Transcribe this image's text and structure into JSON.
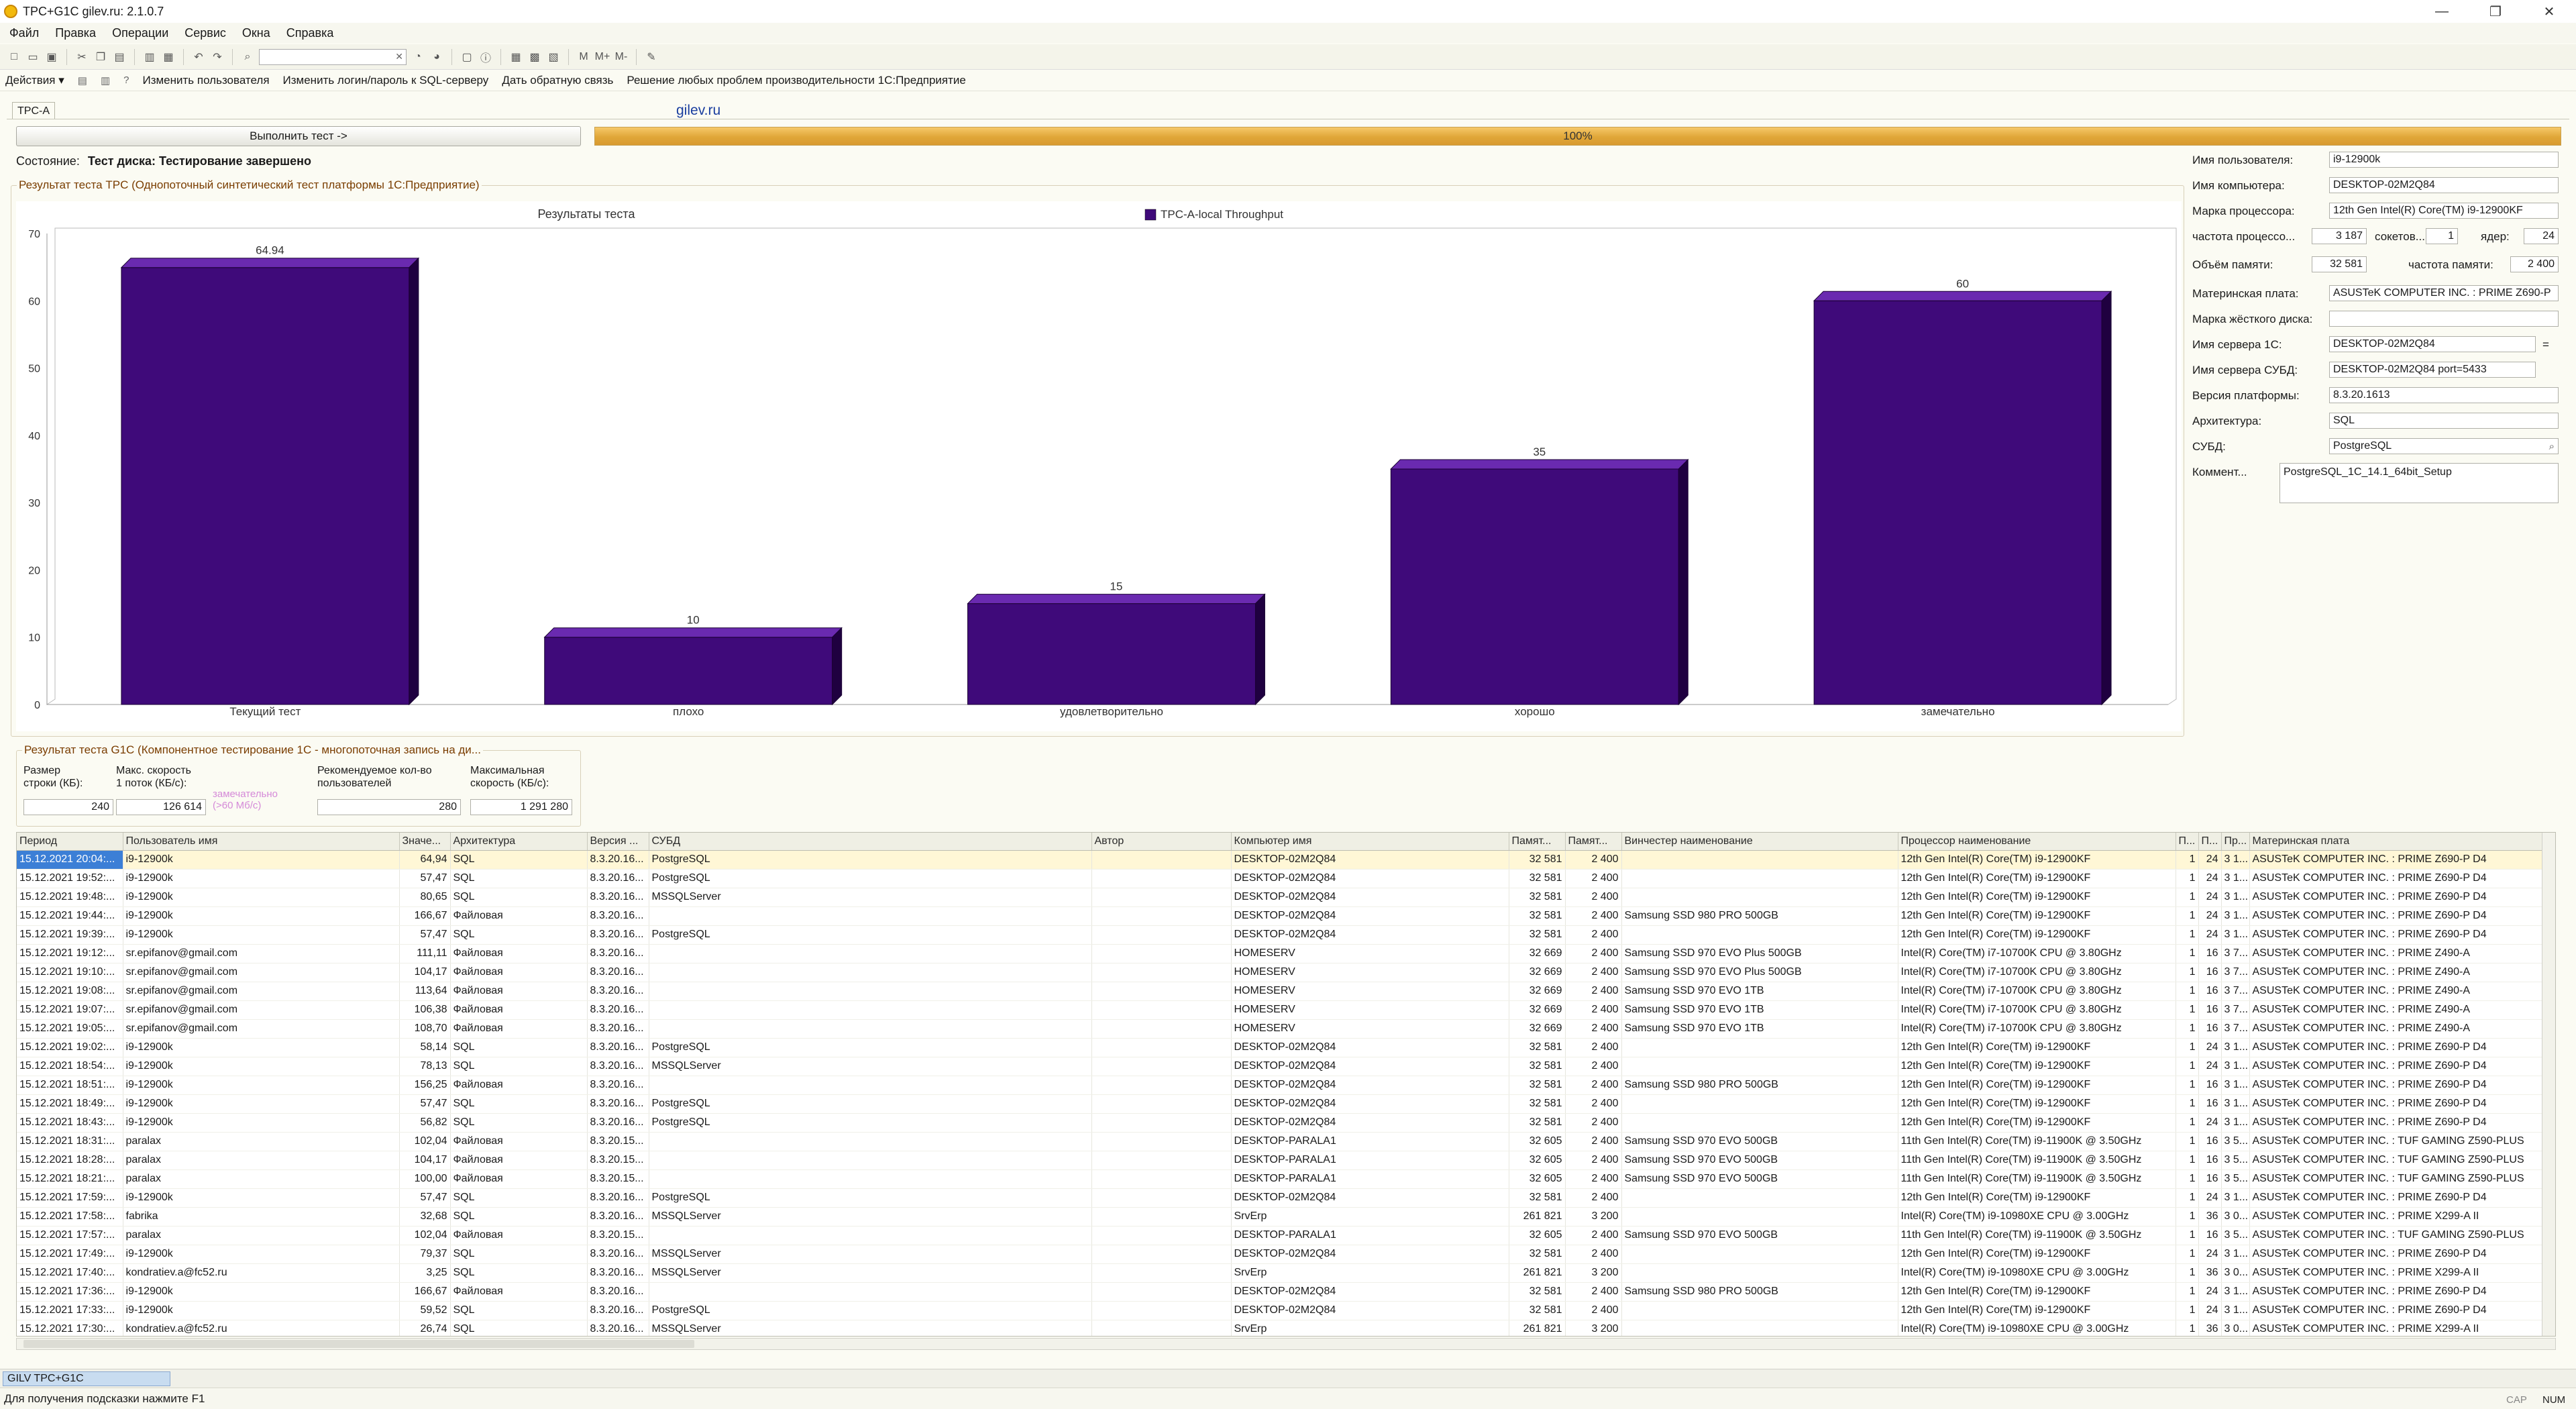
{
  "window": {
    "title": "TPC+G1C gilev.ru: 2.1.0.7",
    "controls": [
      "—",
      "❐",
      "✕"
    ]
  },
  "menu": [
    "Файл",
    "Правка",
    "Операции",
    "Сервис",
    "Окна",
    "Справка"
  ],
  "actions": {
    "menu_label": "Действия ▾",
    "links": [
      "Изменить пользователя",
      "Изменить логин/пароль к SQL-серверу",
      "Дать обратную связь",
      "Решение любых проблем производительности 1С:Предприятие"
    ]
  },
  "tab": {
    "label": "TPC-A"
  },
  "site": "gilev.ru",
  "run_button": "Выполнить тест ->",
  "progress": {
    "label": "100%",
    "value": 100
  },
  "status": {
    "label": "Состояние:",
    "value": "Тест диска: Тестирование завершено"
  },
  "tpc_group": {
    "title": "Результат теста TPC (Однопоточный синтетический тест платформы 1С:Предприятие)"
  },
  "chart_data": {
    "type": "bar",
    "title": "Результаты теста",
    "legend": "top-center",
    "series": [
      {
        "name": "TPC-A-local Throughput",
        "values": [
          64.94,
          10,
          15,
          35,
          60
        ]
      }
    ],
    "categories": [
      "Текущий тест",
      "плохо",
      "удовлетворительно",
      "хорошо",
      "замечательно"
    ],
    "value_labels": [
      "64.94",
      "10",
      "15",
      "35",
      "60"
    ],
    "ylim": [
      0,
      70
    ],
    "yticks": [
      "0",
      "10",
      "20",
      "30",
      "40",
      "50",
      "60",
      "70"
    ],
    "grid": false,
    "colors": {
      "bar": "#3f0a7a",
      "bar_top": "#6a2ab0",
      "bar_side": "#1f0040"
    }
  },
  "g1c_group": {
    "title": "Результат теста G1C (Компонентное тестирование 1С - многопоточная запись на ди...",
    "fields": [
      {
        "label1": "Размер",
        "label2": "строки (КБ):",
        "value": "240"
      },
      {
        "label1": "Макс. скорость",
        "label2": "1 поток (КБ/с):",
        "value": "126 614"
      },
      {
        "label1": "Рекомендуемое кол-во",
        "label2": "пользователей",
        "value": "280"
      },
      {
        "label1": "Максимальная",
        "label2": "скорость (КБ/с):",
        "value": "1 291 280"
      }
    ],
    "rating": {
      "line1": "замечательно",
      "line2": "(>60 Мб/с)"
    }
  },
  "info": {
    "user": {
      "label": "Имя пользователя:",
      "value": "i9-12900k"
    },
    "computer": {
      "label": "Имя компьютера:",
      "value": "DESKTOP-02M2Q84"
    },
    "cpu": {
      "label": "Марка процессора:",
      "value": "12th Gen Intel(R) Core(TM) i9-12900KF"
    },
    "freq": {
      "label": "частота процессо...",
      "value": "3 187"
    },
    "sockets": {
      "label": "сокетов...",
      "value": "1"
    },
    "cores": {
      "label": "ядер:",
      "value": "24"
    },
    "ram": {
      "label": "Объём памяти:",
      "value": "32 581"
    },
    "ram_freq": {
      "label": "частота памяти:",
      "value": "2 400"
    },
    "mb": {
      "label": "Материнская плата:",
      "value": "ASUSTeK COMPUTER INC. : PRIME Z690-P"
    },
    "disk": {
      "label": "Марка жёсткого диска:",
      "value": ""
    },
    "server1c": {
      "label": "Имя сервера 1С:",
      "value": "DESKTOP-02M2Q84",
      "suffix": "="
    },
    "dbserver": {
      "label": "Имя сервера СУБД:",
      "value": "DESKTOP-02M2Q84 port=5433"
    },
    "platform": {
      "label": "Версия платформы:",
      "value": "8.3.20.1613"
    },
    "arch": {
      "label": "Архитектура:",
      "value": "SQL"
    },
    "dbms": {
      "label": "СУБД:",
      "value": "PostgreSQL"
    },
    "comment": {
      "label": "Коммент...",
      "value": "PostgreSQL_1C_14.1_64bit_Setup"
    }
  },
  "grid": {
    "columns": [
      "Период",
      "Пользователь имя",
      "Значе...",
      "Архитектура",
      "Версия ...",
      "СУБД",
      "Автор",
      "Компьютер имя",
      "Памят...",
      "Памят...",
      "Винчестер наименование",
      "Процессор наименование",
      "П...",
      "П...",
      "Пр...",
      "Материнская плата"
    ],
    "rows": [
      [
        "15.12.2021 20:04:...",
        "i9-12900k",
        "64,94",
        "SQL",
        "8.3.20.16...",
        "PostgreSQL",
        "",
        "DESKTOP-02M2Q84",
        "32 581",
        "2 400",
        "",
        "12th Gen Intel(R) Core(TM) i9-12900KF",
        "1",
        "24",
        "3 1...",
        "ASUSTeK COMPUTER INC. : PRIME Z690-P D4"
      ],
      [
        "15.12.2021 19:52:...",
        "i9-12900k",
        "57,47",
        "SQL",
        "8.3.20.16...",
        "PostgreSQL",
        "",
        "DESKTOP-02M2Q84",
        "32 581",
        "2 400",
        "",
        "12th Gen Intel(R) Core(TM) i9-12900KF",
        "1",
        "24",
        "3 1...",
        "ASUSTeK COMPUTER INC. : PRIME Z690-P D4"
      ],
      [
        "15.12.2021 19:48:...",
        "i9-12900k",
        "80,65",
        "SQL",
        "8.3.20.16...",
        "MSSQLServer",
        "",
        "DESKTOP-02M2Q84",
        "32 581",
        "2 400",
        "",
        "12th Gen Intel(R) Core(TM) i9-12900KF",
        "1",
        "24",
        "3 1...",
        "ASUSTeK COMPUTER INC. : PRIME Z690-P D4"
      ],
      [
        "15.12.2021 19:44:...",
        "i9-12900k",
        "166,67",
        "Файловая",
        "8.3.20.16...",
        "",
        "",
        "DESKTOP-02M2Q84",
        "32 581",
        "2 400",
        "Samsung SSD 980 PRO 500GB",
        "12th Gen Intel(R) Core(TM) i9-12900KF",
        "1",
        "24",
        "3 1...",
        "ASUSTeK COMPUTER INC. : PRIME Z690-P D4"
      ],
      [
        "15.12.2021 19:39:...",
        "i9-12900k",
        "57,47",
        "SQL",
        "8.3.20.16...",
        "PostgreSQL",
        "",
        "DESKTOP-02M2Q84",
        "32 581",
        "2 400",
        "",
        "12th Gen Intel(R) Core(TM) i9-12900KF",
        "1",
        "24",
        "3 1...",
        "ASUSTeK COMPUTER INC. : PRIME Z690-P D4"
      ],
      [
        "15.12.2021 19:12:...",
        "sr.epifanov@gmail.com",
        "111,11",
        "Файловая",
        "8.3.20.16...",
        "",
        "",
        "HOMESERV",
        "32 669",
        "2 400",
        "Samsung SSD 970 EVO Plus 500GB",
        "Intel(R) Core(TM) i7-10700K CPU @ 3.80GHz",
        "1",
        "16",
        "3 7...",
        "ASUSTeK COMPUTER INC. : PRIME Z490-A"
      ],
      [
        "15.12.2021 19:10:...",
        "sr.epifanov@gmail.com",
        "104,17",
        "Файловая",
        "8.3.20.16...",
        "",
        "",
        "HOMESERV",
        "32 669",
        "2 400",
        "Samsung SSD 970 EVO Plus 500GB",
        "Intel(R) Core(TM) i7-10700K CPU @ 3.80GHz",
        "1",
        "16",
        "3 7...",
        "ASUSTeK COMPUTER INC. : PRIME Z490-A"
      ],
      [
        "15.12.2021 19:08:...",
        "sr.epifanov@gmail.com",
        "113,64",
        "Файловая",
        "8.3.20.16...",
        "",
        "",
        "HOMESERV",
        "32 669",
        "2 400",
        "Samsung SSD 970 EVO 1TB",
        "Intel(R) Core(TM) i7-10700K CPU @ 3.80GHz",
        "1",
        "16",
        "3 7...",
        "ASUSTeK COMPUTER INC. : PRIME Z490-A"
      ],
      [
        "15.12.2021 19:07:...",
        "sr.epifanov@gmail.com",
        "106,38",
        "Файловая",
        "8.3.20.16...",
        "",
        "",
        "HOMESERV",
        "32 669",
        "2 400",
        "Samsung SSD 970 EVO 1TB",
        "Intel(R) Core(TM) i7-10700K CPU @ 3.80GHz",
        "1",
        "16",
        "3 7...",
        "ASUSTeK COMPUTER INC. : PRIME Z490-A"
      ],
      [
        "15.12.2021 19:05:...",
        "sr.epifanov@gmail.com",
        "108,70",
        "Файловая",
        "8.3.20.16...",
        "",
        "",
        "HOMESERV",
        "32 669",
        "2 400",
        "Samsung SSD 970 EVO 1TB",
        "Intel(R) Core(TM) i7-10700K CPU @ 3.80GHz",
        "1",
        "16",
        "3 7...",
        "ASUSTeK COMPUTER INC. : PRIME Z490-A"
      ],
      [
        "15.12.2021 19:02:...",
        "i9-12900k",
        "58,14",
        "SQL",
        "8.3.20.16...",
        "PostgreSQL",
        "",
        "DESKTOP-02M2Q84",
        "32 581",
        "2 400",
        "",
        "12th Gen Intel(R) Core(TM) i9-12900KF",
        "1",
        "24",
        "3 1...",
        "ASUSTeK COMPUTER INC. : PRIME Z690-P D4"
      ],
      [
        "15.12.2021 18:54:...",
        "i9-12900k",
        "78,13",
        "SQL",
        "8.3.20.16...",
        "MSSQLServer",
        "",
        "DESKTOP-02M2Q84",
        "32 581",
        "2 400",
        "",
        "12th Gen Intel(R) Core(TM) i9-12900KF",
        "1",
        "24",
        "3 1...",
        "ASUSTeK COMPUTER INC. : PRIME Z690-P D4"
      ],
      [
        "15.12.2021 18:51:...",
        "i9-12900k",
        "156,25",
        "Файловая",
        "8.3.20.16...",
        "",
        "",
        "DESKTOP-02M2Q84",
        "32 581",
        "2 400",
        "Samsung SSD 980 PRO 500GB",
        "12th Gen Intel(R) Core(TM) i9-12900KF",
        "1",
        "16",
        "3 1...",
        "ASUSTeK COMPUTER INC. : PRIME Z690-P D4"
      ],
      [
        "15.12.2021 18:49:...",
        "i9-12900k",
        "57,47",
        "SQL",
        "8.3.20.16...",
        "PostgreSQL",
        "",
        "DESKTOP-02M2Q84",
        "32 581",
        "2 400",
        "",
        "12th Gen Intel(R) Core(TM) i9-12900KF",
        "1",
        "16",
        "3 1...",
        "ASUSTeK COMPUTER INC. : PRIME Z690-P D4"
      ],
      [
        "15.12.2021 18:43:...",
        "i9-12900k",
        "56,82",
        "SQL",
        "8.3.20.16...",
        "PostgreSQL",
        "",
        "DESKTOP-02M2Q84",
        "32 581",
        "2 400",
        "",
        "12th Gen Intel(R) Core(TM) i9-12900KF",
        "1",
        "24",
        "3 1...",
        "ASUSTeK COMPUTER INC. : PRIME Z690-P D4"
      ],
      [
        "15.12.2021 18:31:...",
        "paralax",
        "102,04",
        "Файловая",
        "8.3.20.15...",
        "",
        "",
        "DESKTOP-PARALA1",
        "32 605",
        "2 400",
        "Samsung SSD 970 EVO 500GB",
        "11th Gen Intel(R) Core(TM) i9-11900K @ 3.50GHz",
        "1",
        "16",
        "3 5...",
        "ASUSTeK COMPUTER INC. : TUF GAMING Z590-PLUS"
      ],
      [
        "15.12.2021 18:28:...",
        "paralax",
        "104,17",
        "Файловая",
        "8.3.20.15...",
        "",
        "",
        "DESKTOP-PARALA1",
        "32 605",
        "2 400",
        "Samsung SSD 970 EVO 500GB",
        "11th Gen Intel(R) Core(TM) i9-11900K @ 3.50GHz",
        "1",
        "16",
        "3 5...",
        "ASUSTeK COMPUTER INC. : TUF GAMING Z590-PLUS"
      ],
      [
        "15.12.2021 18:21:...",
        "paralax",
        "100,00",
        "Файловая",
        "8.3.20.15...",
        "",
        "",
        "DESKTOP-PARALA1",
        "32 605",
        "2 400",
        "Samsung SSD 970 EVO 500GB",
        "11th Gen Intel(R) Core(TM) i9-11900K @ 3.50GHz",
        "1",
        "16",
        "3 5...",
        "ASUSTeK COMPUTER INC. : TUF GAMING Z590-PLUS"
      ],
      [
        "15.12.2021 17:59:...",
        "i9-12900k",
        "57,47",
        "SQL",
        "8.3.20.16...",
        "PostgreSQL",
        "",
        "DESKTOP-02M2Q84",
        "32 581",
        "2 400",
        "",
        "12th Gen Intel(R) Core(TM) i9-12900KF",
        "1",
        "24",
        "3 1...",
        "ASUSTeK COMPUTER INC. : PRIME Z690-P D4"
      ],
      [
        "15.12.2021 17:58:...",
        "fabrika",
        "32,68",
        "SQL",
        "8.3.20.16...",
        "MSSQLServer",
        "",
        "SrvErp",
        "261 821",
        "3 200",
        "",
        "Intel(R) Core(TM) i9-10980XE CPU @ 3.00GHz",
        "1",
        "36",
        "3 0...",
        "ASUSTeK COMPUTER INC. : PRIME X299-A II"
      ],
      [
        "15.12.2021 17:57:...",
        "paralax",
        "102,04",
        "Файловая",
        "8.3.20.15...",
        "",
        "",
        "DESKTOP-PARALA1",
        "32 605",
        "2 400",
        "Samsung SSD 970 EVO 500GB",
        "11th Gen Intel(R) Core(TM) i9-11900K @ 3.50GHz",
        "1",
        "16",
        "3 5...",
        "ASUSTeK COMPUTER INC. : TUF GAMING Z590-PLUS"
      ],
      [
        "15.12.2021 17:49:...",
        "i9-12900k",
        "79,37",
        "SQL",
        "8.3.20.16...",
        "MSSQLServer",
        "",
        "DESKTOP-02M2Q84",
        "32 581",
        "2 400",
        "",
        "12th Gen Intel(R) Core(TM) i9-12900KF",
        "1",
        "24",
        "3 1...",
        "ASUSTeK COMPUTER INC. : PRIME Z690-P D4"
      ],
      [
        "15.12.2021 17:40:...",
        "kondratiev.a@fc52.ru",
        "3,25",
        "SQL",
        "8.3.20.16...",
        "MSSQLServer",
        "",
        "SrvErp",
        "261 821",
        "3 200",
        "",
        "Intel(R) Core(TM) i9-10980XE CPU @ 3.00GHz",
        "1",
        "36",
        "3 0...",
        "ASUSTeK COMPUTER INC. : PRIME X299-A II"
      ],
      [
        "15.12.2021 17:36:...",
        "i9-12900k",
        "166,67",
        "Файловая",
        "8.3.20.16...",
        "",
        "",
        "DESKTOP-02M2Q84",
        "32 581",
        "2 400",
        "Samsung SSD 980 PRO 500GB",
        "12th Gen Intel(R) Core(TM) i9-12900KF",
        "1",
        "24",
        "3 1...",
        "ASUSTeK COMPUTER INC. : PRIME Z690-P D4"
      ],
      [
        "15.12.2021 17:33:...",
        "i9-12900k",
        "59,52",
        "SQL",
        "8.3.20.16...",
        "PostgreSQL",
        "",
        "DESKTOP-02M2Q84",
        "32 581",
        "2 400",
        "",
        "12th Gen Intel(R) Core(TM) i9-12900KF",
        "1",
        "24",
        "3 1...",
        "ASUSTeK COMPUTER INC. : PRIME Z690-P D4"
      ],
      [
        "15.12.2021 17:30:...",
        "kondratiev.a@fc52.ru",
        "26,74",
        "SQL",
        "8.3.20.16...",
        "MSSQLServer",
        "",
        "SrvErp",
        "261 821",
        "3 200",
        "",
        "Intel(R) Core(TM) i9-10980XE CPU @ 3.00GHz",
        "1",
        "36",
        "3 0...",
        "ASUSTeK COMPUTER INC. : PRIME X299-A II"
      ]
    ]
  },
  "taskbar": {
    "item": "GILV TPC+G1C"
  },
  "statusbar": {
    "hint": "Для получения подсказки нажмите F1",
    "cap": "CAP",
    "num": "NUM"
  }
}
